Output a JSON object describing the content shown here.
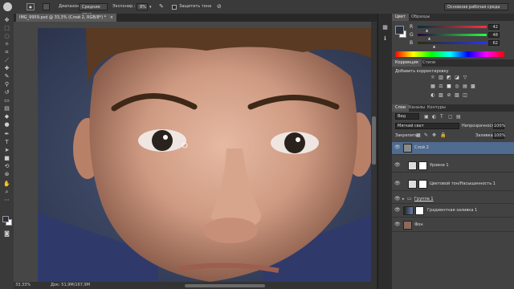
{
  "options_bar": {
    "range_label": "Диапазон:",
    "range_value": "Средние тона",
    "exposure_label": "Экспонир.:",
    "exposure_value": "8%",
    "protect_tones_label": "Защитить тона",
    "workspace": "Основная рабочая среда"
  },
  "document": {
    "tab_title": "IMG_9959.psd @ 33,3% (Слой 2, RGB/8*) *",
    "tab_close": "×",
    "zoom": "33,33%",
    "doc_info": "Док: 51,9M/167,9M"
  },
  "color_panel": {
    "tabs": [
      "Цвет",
      "Образцы"
    ],
    "r_label": "R",
    "g_label": "G",
    "b_label": "B",
    "r_value": "42",
    "g_value": "48",
    "b_value": "62",
    "fg_color": "#2a303e",
    "bg_color": "#ffffff"
  },
  "adjustments_panel": {
    "tabs": [
      "Коррекция",
      "Стили"
    ],
    "add_label": "Добавить корректировку",
    "row1_icons": [
      "☼",
      "▥",
      "◩",
      "◪",
      "▽"
    ],
    "row2_icons": [
      "▦",
      "⚖",
      "■",
      "◎",
      "▤",
      "▩"
    ],
    "row3_icons": [
      "◐",
      "▨",
      "⊘",
      "▧",
      "◫"
    ]
  },
  "layers_panel": {
    "tabs": [
      "Слои",
      "Каналы",
      "Контуры"
    ],
    "kind_label": "Вид",
    "blend_mode": "Мягкий свет",
    "opacity_label": "Непрозрачность:",
    "opacity_value": "100%",
    "lock_label": "Закрепить:",
    "fill_label": "Заливка:",
    "fill_value": "100%",
    "layers": [
      {
        "name": "Слой 2",
        "selected": true
      },
      {
        "name": "Уровни 1",
        "selected": false
      },
      {
        "name": "Цветовой тон/Насыщенность 1",
        "selected": false
      },
      {
        "name": "Группа 1",
        "selected": false
      },
      {
        "name": "Градиентная заливка 1",
        "selected": false
      },
      {
        "name": "Фон",
        "selected": false
      }
    ]
  }
}
